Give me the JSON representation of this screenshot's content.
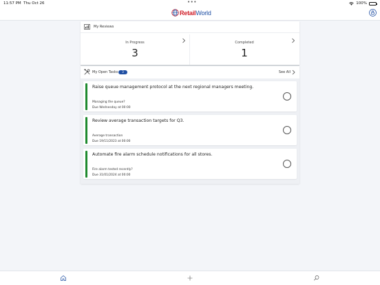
{
  "status_bar": {
    "time": "11:57 PM",
    "date": "Thu Oct 26",
    "battery": "100%"
  },
  "app": {
    "brand_part1": "Retail",
    "brand_part2": "World",
    "brand_colors": {
      "red": "#d0202a",
      "blue": "#1f4fa3"
    }
  },
  "reviews": {
    "title": "My Reviews",
    "stats": [
      {
        "label": "In Progress",
        "value": "3"
      },
      {
        "label": "Completed",
        "value": "1"
      }
    ]
  },
  "tasks": {
    "title": "My Open Tasks",
    "count": "3",
    "see_all": "See All",
    "accent_color": "#1f8a2f",
    "items": [
      {
        "title": "Raise queue management protocol at the next regional managers meeting.",
        "subtitle": "Managing the queue?",
        "due": "Due Wednesday at 00:00"
      },
      {
        "title": "Review average transaction targets for Q3.",
        "subtitle": "Average transaction",
        "due": "Due 19/11/2023 at 00:00"
      },
      {
        "title": "Automate fire alarm schedule notifications for all stores.",
        "subtitle": "Fire alarm tested recently?",
        "due": "Due 31/01/2024 at 00:00"
      }
    ]
  },
  "tab_bar": {
    "icons": [
      "home-icon",
      "plus-icon",
      "search-icon"
    ]
  }
}
